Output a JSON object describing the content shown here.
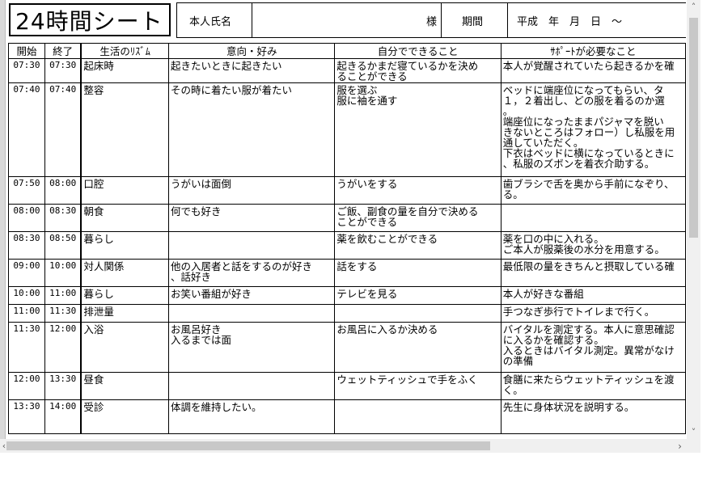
{
  "header": {
    "title": "24時間シート",
    "name_label": "本人氏名",
    "honorific": "様",
    "period_label": "期間",
    "period_value": "平成　年　月　日　～"
  },
  "columns": [
    "開始",
    "終了",
    "生活のﾘｽﾞﾑ",
    "意向・好み",
    "自分でできること",
    "ｻﾎﾟｰﾄが必要なこと"
  ],
  "rows": [
    {
      "start": "07:30",
      "end": "07:30",
      "rhythm": "起床時",
      "pref": "起きたいときに起きたい",
      "self": "起きるかまだ寝ているかを決め\nることができる",
      "support": "本人が覚醒されていたら起きるかを確"
    },
    {
      "start": "07:40",
      "end": "07:40",
      "rhythm": "整容",
      "pref": "その時に着たい服が着たい",
      "self": "服を選ぶ\n服に袖を通す",
      "support": "ベッドに端座位になってもらい、タ\n１，２着出し、どの服を着るのか選\n。\n端座位になったままパジャマを脱い\nきないところはフォロー）し私服を用\n通していただく。\n下衣はベッドに横になっているときに\n、私服のズボンを着衣介助する。"
    },
    {
      "start": "07:50",
      "end": "08:00",
      "rhythm": "口腔",
      "pref": "うがいは面倒",
      "self": "うがいをする",
      "support": "歯ブラシで舌を奥から手前になぞり、\nる。"
    },
    {
      "start": "08:00",
      "end": "08:30",
      "rhythm": "朝食",
      "pref": "何でも好き",
      "self": "ご飯、副食の量を自分で決める\nことができる",
      "support": ""
    },
    {
      "start": "08:30",
      "end": "08:50",
      "rhythm": "暮らし",
      "pref": "",
      "self": "薬を飲むことができる",
      "support": "薬を口の中に入れる。\nご本人が服薬後の水分を用意する。"
    },
    {
      "start": "09:00",
      "end": "10:00",
      "rhythm": "対人関係",
      "pref": "他の入居者と話をするのが好き\n、話好き",
      "self": "話をする",
      "support": "最低限の量をきちんと摂取している確"
    },
    {
      "start": "10:00",
      "end": "11:00",
      "rhythm": "暮らし",
      "pref": "お笑い番組が好き",
      "self": "テレビを見る",
      "support": "本人が好きな番組"
    },
    {
      "start": "11:00",
      "end": "11:30",
      "rhythm": "排泄量",
      "pref": "",
      "self": "",
      "support": "手つなぎ歩行でトイレまで行く。"
    },
    {
      "start": "11:30",
      "end": "12:00",
      "rhythm": "入浴",
      "pref": "お風呂好き\n入るまでは面",
      "self": "お風呂に入るか決める",
      "support": "バイタルを測定する。本人に意思確認\nに入るかを確認する。\n入るときはバイタル測定。異常がなけ\nの準備"
    },
    {
      "start": "12:00",
      "end": "13:30",
      "rhythm": "昼食",
      "pref": "",
      "self": "ウェットティッシュで手をふく",
      "support": "食膳に来たらウェットティッシュを渡\nく。"
    },
    {
      "start": "13:30",
      "end": "14:00",
      "rhythm": "受診",
      "pref": "体調を維持したい。",
      "self": "",
      "support": "先生に身体状況を説明する。"
    }
  ],
  "scroll": {
    "up_icon": "˄",
    "down_icon": "˅",
    "left_icon": "‹",
    "right_icon": "›"
  }
}
